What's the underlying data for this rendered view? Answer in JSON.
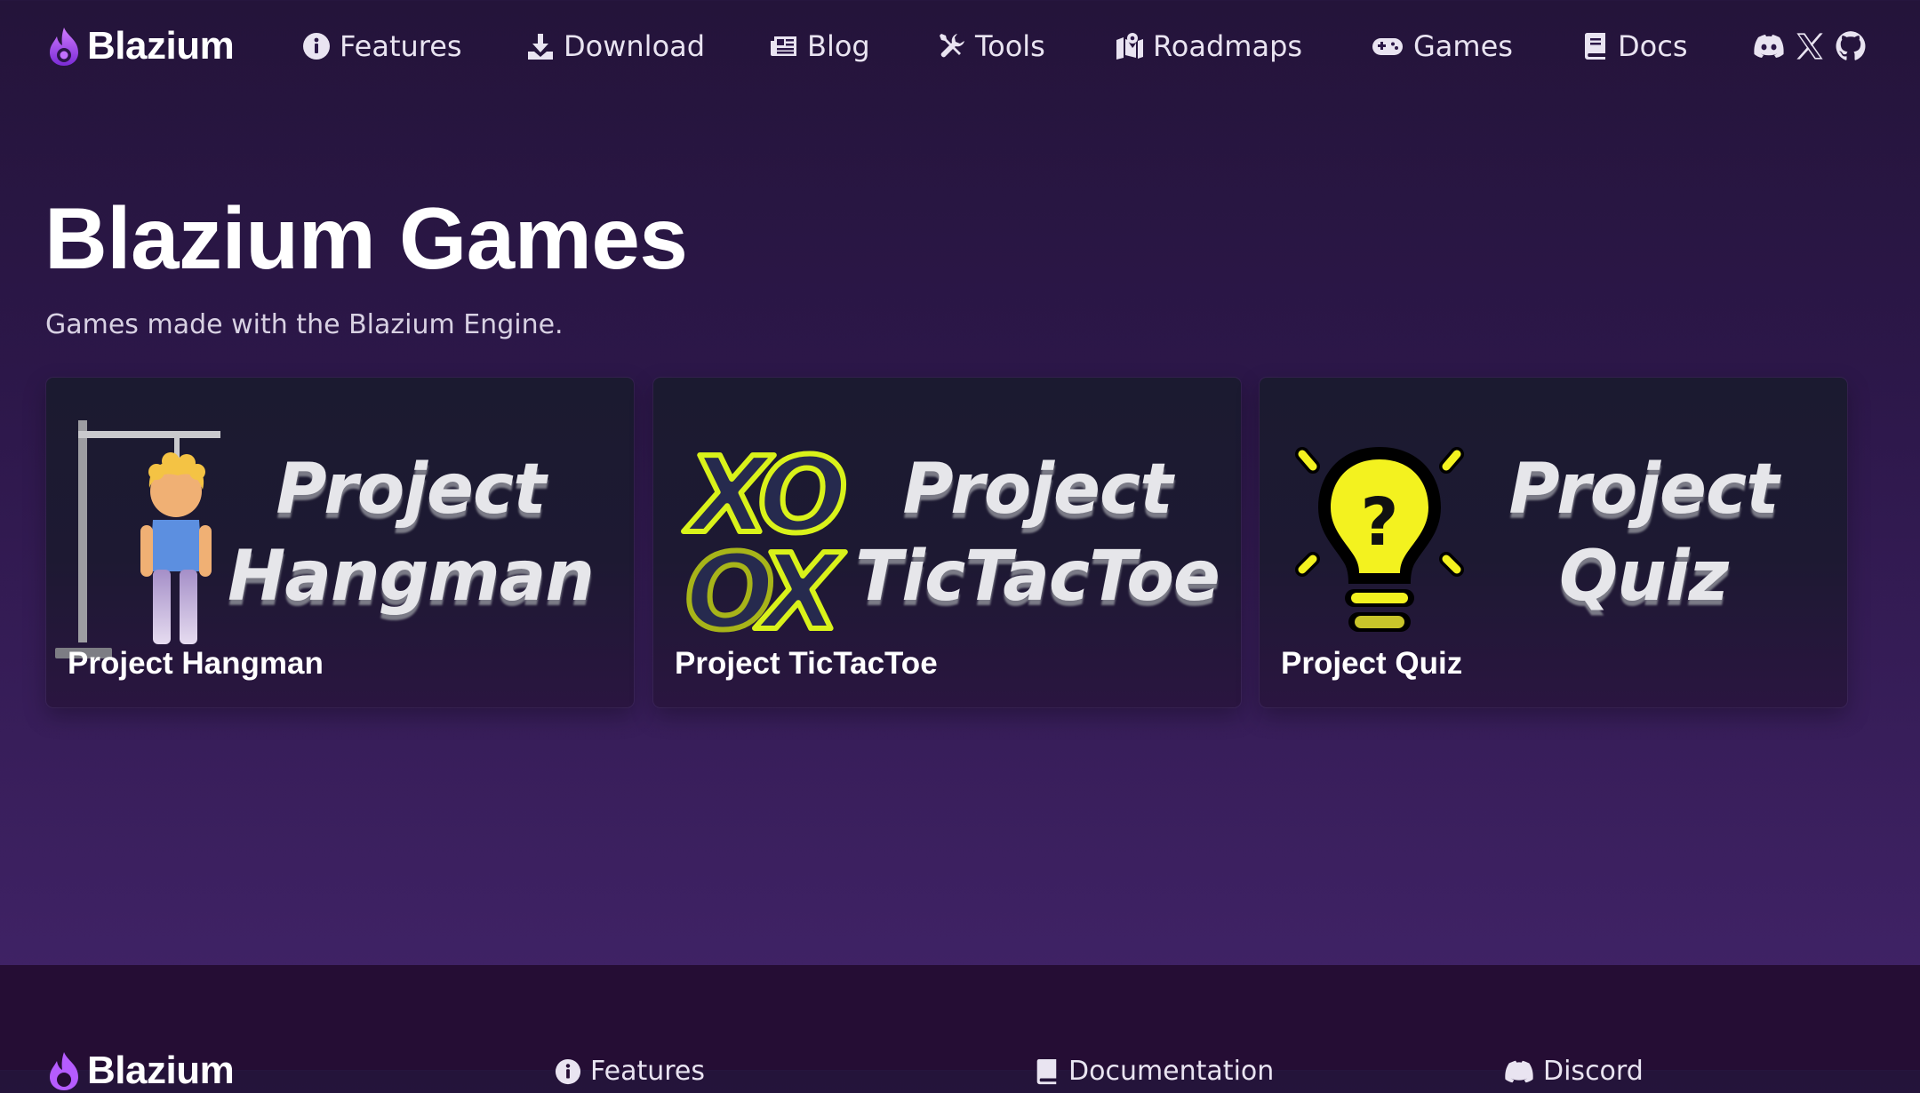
{
  "brand": {
    "name": "Blazium",
    "logo_icon": "flame-icon"
  },
  "nav": {
    "items": [
      {
        "label": "Features",
        "icon": "info-circle-icon"
      },
      {
        "label": "Download",
        "icon": "download-icon"
      },
      {
        "label": "Blog",
        "icon": "newspaper-icon"
      },
      {
        "label": "Tools",
        "icon": "tools-icon"
      },
      {
        "label": "Roadmaps",
        "icon": "map-icon"
      },
      {
        "label": "Games",
        "icon": "gamepad-icon"
      },
      {
        "label": "Docs",
        "icon": "book-icon"
      }
    ],
    "social": [
      "discord-icon",
      "x-icon",
      "github-icon"
    ]
  },
  "hero": {
    "title": "Blazium Games",
    "subtitle": "Games made with the Blazium Engine."
  },
  "cards": [
    {
      "label": "Project Hangman",
      "art_line1": "Project",
      "art_line2": "Hangman"
    },
    {
      "label": "Project TicTacToe",
      "art_line1": "Project",
      "art_line2": "TicTacToe"
    },
    {
      "label": "Project Quiz",
      "art_line1": "Project",
      "art_line2": "Quiz"
    }
  ],
  "footer": {
    "brand": "Blazium",
    "links": [
      {
        "label": "Features",
        "icon": "info-circle-icon"
      },
      {
        "label": "Documentation",
        "icon": "book-icon"
      },
      {
        "label": "Discord",
        "icon": "discord-icon"
      }
    ]
  },
  "colors": {
    "accent_purple": "#a64dff",
    "neon_yellow": "#e4ff1a",
    "bg_top": "#24143a",
    "footer_bg": "#250d34"
  }
}
